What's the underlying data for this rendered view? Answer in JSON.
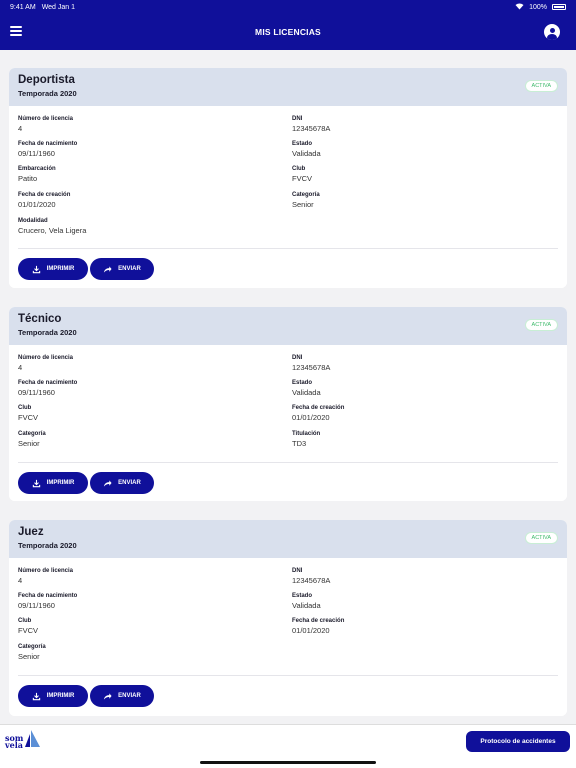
{
  "status_bar": {
    "time": "9:41 AM",
    "date": "Wed Jan 1",
    "battery": "100%"
  },
  "header": {
    "title": "MIS LICENCIAS",
    "menu_icon": "hamburger-icon",
    "profile_icon": "user-icon"
  },
  "licenses": [
    {
      "type": "Deportista",
      "season": "Temporada 2020",
      "status": "ACTIVA",
      "fields": [
        {
          "label": "Número de licencia",
          "value": "4"
        },
        {
          "label": "DNI",
          "value": "12345678A"
        },
        {
          "label": "Fecha de nacimiento",
          "value": "09/11/1960"
        },
        {
          "label": "Estado",
          "value": "Validada"
        },
        {
          "label": "Embarcación",
          "value": "Patito"
        },
        {
          "label": "Club",
          "value": "FVCV"
        },
        {
          "label": "Fecha de creación",
          "value": "01/01/2020"
        },
        {
          "label": "Categoría",
          "value": "Senior"
        },
        {
          "label": "Modalidad",
          "value": "Crucero, Vela Ligera"
        }
      ],
      "print_label": "IMPRIMIR",
      "send_label": "ENVIAR"
    },
    {
      "type": "Técnico",
      "season": "Temporada 2020",
      "status": "ACTIVA",
      "fields": [
        {
          "label": "Número de licencia",
          "value": "4"
        },
        {
          "label": "DNI",
          "value": "12345678A"
        },
        {
          "label": "Fecha de nacimiento",
          "value": "09/11/1960"
        },
        {
          "label": "Estado",
          "value": "Validada"
        },
        {
          "label": "Club",
          "value": "FVCV"
        },
        {
          "label": "Fecha de creación",
          "value": "01/01/2020"
        },
        {
          "label": "Categoría",
          "value": "Senior"
        },
        {
          "label": "Titulación",
          "value": "TD3"
        }
      ],
      "print_label": "IMPRIMIR",
      "send_label": "ENVIAR"
    },
    {
      "type": "Juez",
      "season": "Temporada 2020",
      "status": "ACTIVA",
      "fields": [
        {
          "label": "Número de licencia",
          "value": "4"
        },
        {
          "label": "DNI",
          "value": "12345678A"
        },
        {
          "label": "Fecha de nacimiento",
          "value": "09/11/1960"
        },
        {
          "label": "Estado",
          "value": "Validada"
        },
        {
          "label": "Club",
          "value": "FVCV"
        },
        {
          "label": "Fecha de creación",
          "value": "01/01/2020"
        },
        {
          "label": "Categoría",
          "value": "Senior"
        }
      ],
      "print_label": "IMPRIMIR",
      "send_label": "ENVIAR"
    }
  ],
  "footer": {
    "logo_text_1": "som",
    "logo_text_2": "vela",
    "accident_button": "Protocolo de accidentes"
  },
  "colors": {
    "primary": "#10109a",
    "header_bg": "#d9e0ed",
    "active": "#3cb96a"
  }
}
